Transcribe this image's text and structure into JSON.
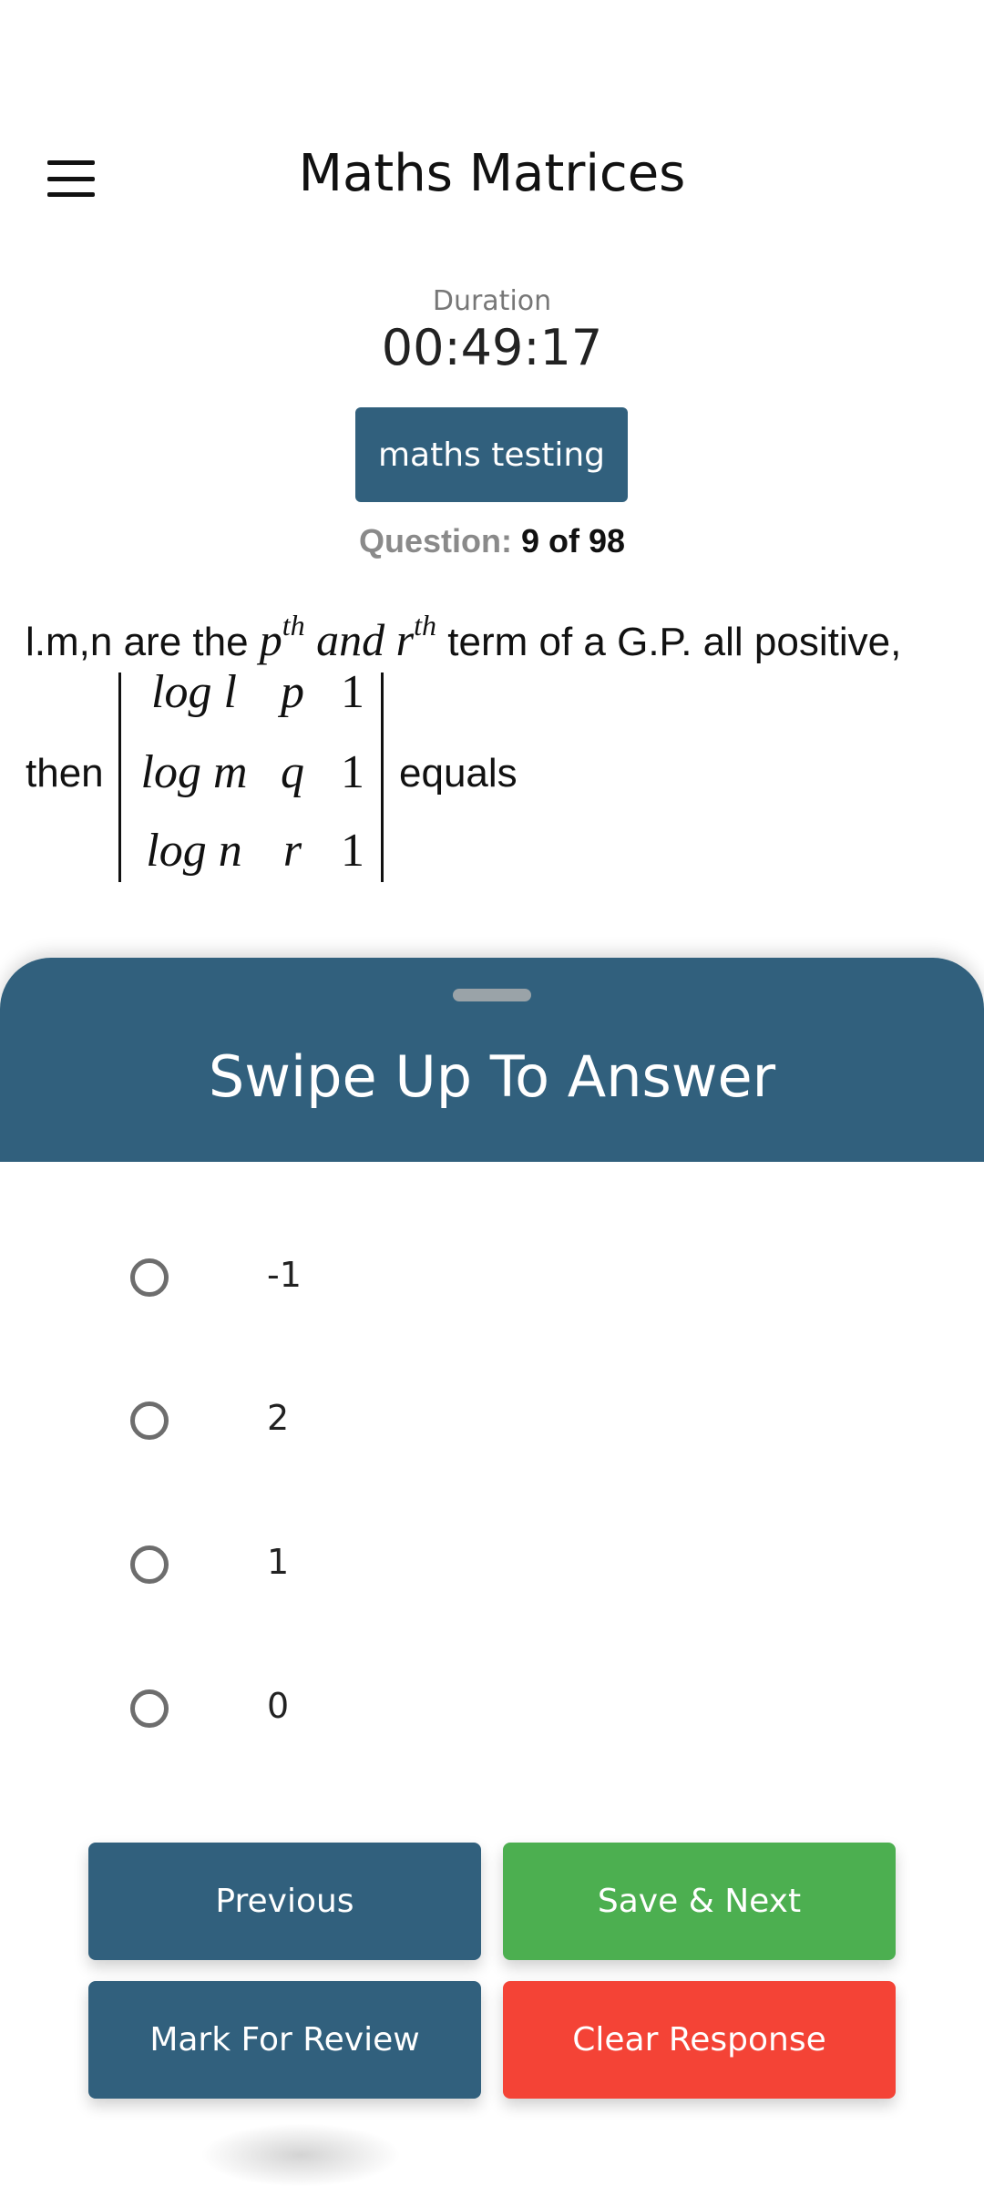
{
  "header": {
    "menu_icon": "hamburger-menu-icon",
    "title": "Maths Matrices"
  },
  "timer": {
    "label": "Duration",
    "value": "00:49:17"
  },
  "section": {
    "label": "maths testing"
  },
  "question_counter": {
    "label": "Question:",
    "value": "9 of 98"
  },
  "question": {
    "text_part1": "l.m,n are the ",
    "p": "p",
    "th1": "th",
    "and": " and ",
    "r": "r",
    "th2": "th",
    "text_part2": " term of a G.P. all positive,",
    "then": "then",
    "determinant": [
      [
        "log l",
        "p",
        "1"
      ],
      [
        "log m",
        "q",
        "1"
      ],
      [
        "log n",
        "r",
        "1"
      ]
    ],
    "equals": "equals"
  },
  "sheet": {
    "title": "Swipe Up To Answer"
  },
  "options": [
    "-1",
    "2",
    "1",
    "0"
  ],
  "buttons": {
    "previous": "Previous",
    "save_next": "Save & Next",
    "mark_review": "Mark For Review",
    "clear_response": "Clear Response"
  },
  "colors": {
    "primary": "#31607d",
    "success": "#4caf50",
    "danger": "#f44336"
  }
}
